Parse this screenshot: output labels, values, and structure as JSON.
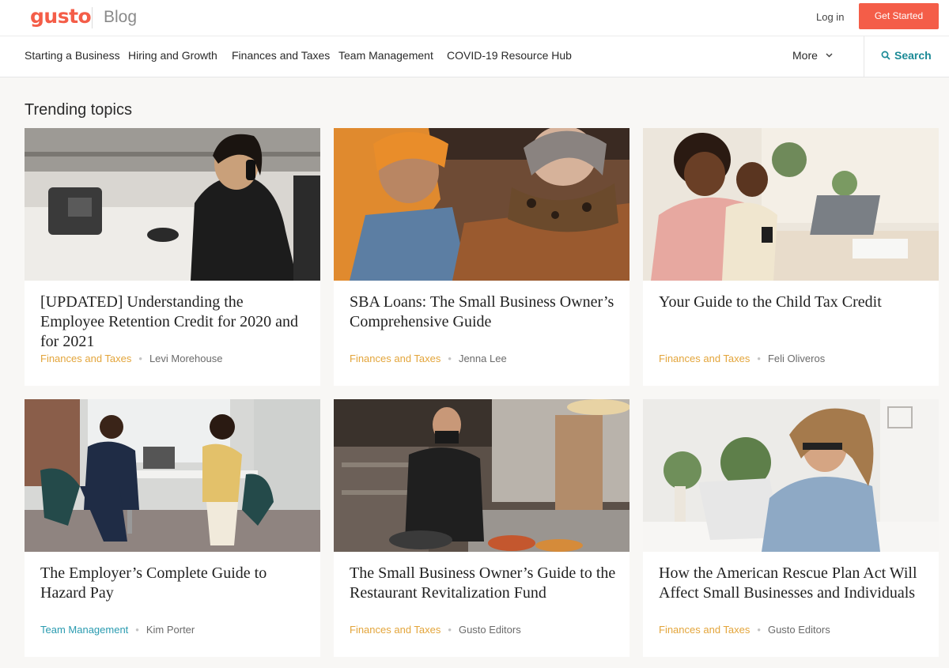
{
  "header": {
    "logo": "gusto",
    "section": "Blog",
    "login_label": "Log in",
    "cta_label": "Get Started"
  },
  "nav": {
    "items": [
      {
        "label": "Starting a Business"
      },
      {
        "label": "Hiring and Growth"
      },
      {
        "label": "Finances and Taxes"
      },
      {
        "label": "Team Management"
      },
      {
        "label": "COVID-19 Resource Hub"
      }
    ],
    "more_label": "More",
    "search_label": "Search"
  },
  "main": {
    "section_title": "Trending topics",
    "cards": [
      {
        "title": "[UPDATED] Understanding the Employee Retention Credit for 2020 and for 2021",
        "category": "Finances and Taxes",
        "author": "Levi Morehouse",
        "image": "woman-on-phone-photo"
      },
      {
        "title": "SBA Loans: The Small Business Owner’s Comprehensive Guide",
        "category": "Finances and Taxes",
        "author": "Jenna Lee",
        "image": "two-women-reading-photo"
      },
      {
        "title": "Your Guide to the Child Tax Credit",
        "category": "Finances and Taxes",
        "author": "Feli Oliveros",
        "image": "mother-and-child-photo"
      },
      {
        "title": "The Employer’s Complete Guide to Hazard Pay",
        "category": "Team Management",
        "author": "Kim Porter",
        "image": "masked-office-workers-photo"
      },
      {
        "title": "The Small Business Owner’s Guide to the Restaurant Revitalization Fund",
        "category": "Finances and Taxes",
        "author": "Gusto Editors",
        "image": "masked-chef-cooking-photo"
      },
      {
        "title": "How the American Rescue Plan Act Will Affect Small Businesses and Individuals",
        "category": "Finances and Taxes",
        "author": "Gusto Editors",
        "image": "woman-at-laptop-photo"
      }
    ]
  },
  "colors": {
    "brand": "#f45d48",
    "category_finance": "#e3a53b",
    "category_team": "#2a9bb0",
    "search_accent": "#1b8a96"
  }
}
